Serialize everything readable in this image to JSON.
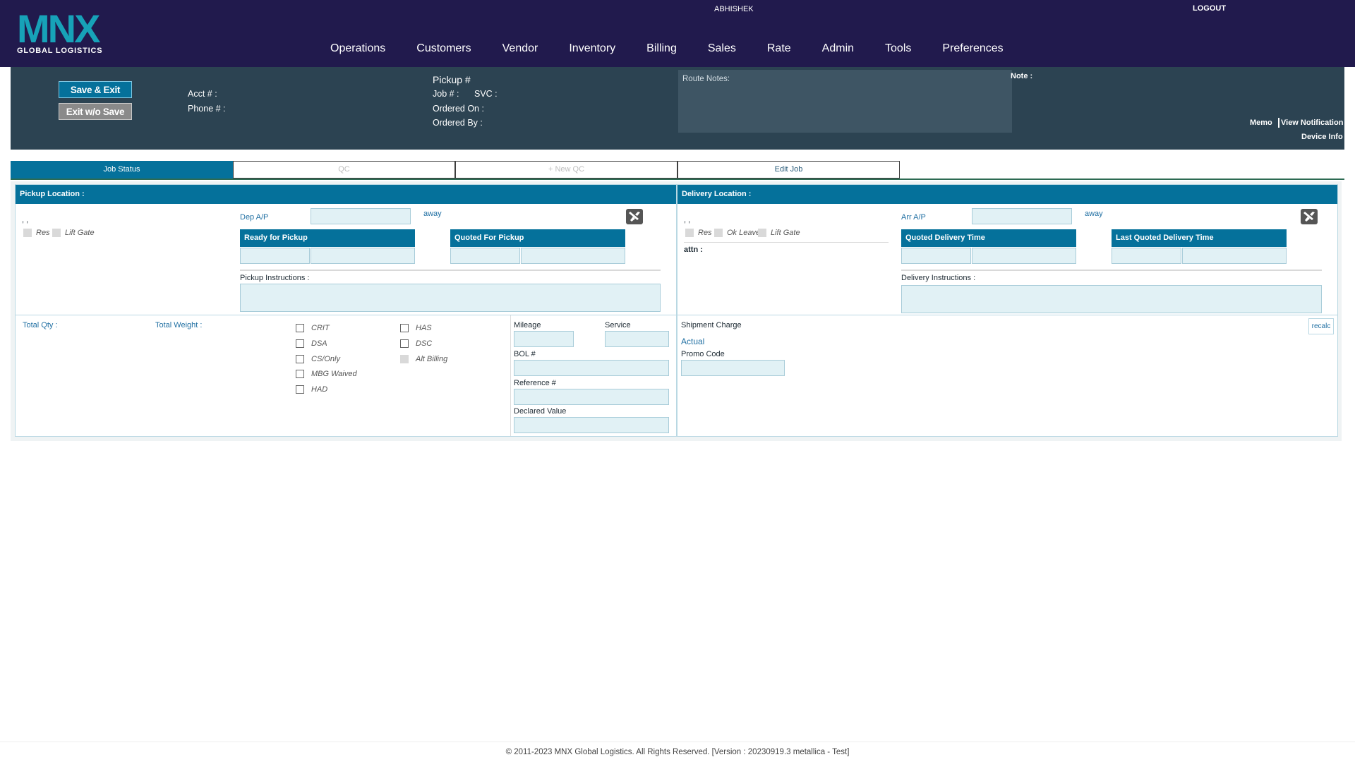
{
  "brand": {
    "logo_text": "MNX",
    "tagline": "GLOBAL LOGISTICS",
    "color": "#17a2b8"
  },
  "user": "ABHISHEK",
  "logout": "LOGOUT",
  "nav": [
    "Operations",
    "Customers",
    "Vendor",
    "Inventory",
    "Billing",
    "Sales",
    "Rate",
    "Admin",
    "Tools",
    "Preferences"
  ],
  "header": {
    "save_exit": "Save & Exit",
    "exit_no_save": "Exit w/o Save",
    "acct": "Acct # :",
    "phone": "Phone # :",
    "pickup": "Pickup #",
    "job": "Job # :",
    "svc": "SVC :",
    "ordered_on": "Ordered On :",
    "ordered_by": "Ordered By :",
    "route_notes": "Route Notes:",
    "note": "Note :",
    "memo": "Memo",
    "view_notification": "View Notification",
    "device_info": "Device Info"
  },
  "tabs": [
    "Job Status",
    "QC",
    "+ New QC",
    "Edit Job"
  ],
  "pickup": {
    "title": "Pickup Location :",
    "address": ", ,",
    "res": "Res",
    "lift_gate": "Lift Gate",
    "dep_ap": "Dep A/P",
    "away": "away",
    "ready": "Ready for Pickup",
    "quoted": "Quoted For Pickup",
    "instructions": "Pickup Instructions :"
  },
  "delivery": {
    "title": "Delivery Location :",
    "address": ", ,",
    "res": "Res",
    "ok_leave": "Ok Leave",
    "lift_gate": "Lift Gate",
    "attn": "attn :",
    "arr_ap": "Arr A/P",
    "away": "away",
    "quoted": "Quoted Delivery Time",
    "last_quoted": "Last Quoted Delivery Time",
    "instructions": "Delivery Instructions :"
  },
  "shipment": {
    "total_qty": "Total Qty :",
    "total_weight": "Total Weight :",
    "options_left": [
      "CRIT",
      "DSA",
      "CS/Only",
      "MBG Waived",
      "HAD"
    ],
    "options_right": [
      "HAS",
      "DSC",
      "Alt Billing"
    ],
    "mileage": "Mileage",
    "service": "Service",
    "bol": "BOL #",
    "reference": "Reference #",
    "declared": "Declared Value"
  },
  "charges": {
    "title": "Shipment Charge",
    "actual": "Actual",
    "promo": "Promo Code",
    "recalc": "recalc"
  },
  "footer": "© 2011-2023 MNX Global Logistics. All Rights Reserved. [Version : 20230919.3 metallica - Test]"
}
